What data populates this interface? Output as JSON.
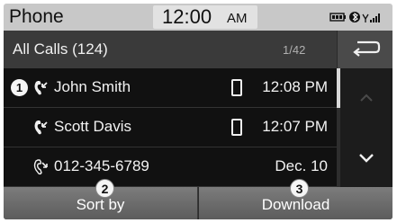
{
  "status_bar": {
    "app_title": "Phone",
    "time": "12:00",
    "ampm": "AM",
    "icons": [
      "battery-icon",
      "bluetooth-icon",
      "signal-icon"
    ]
  },
  "header": {
    "title": "All Calls (124)",
    "page_counter": "1/42",
    "back_icon": "back-arrow-icon"
  },
  "calls": [
    {
      "name": "John Smith",
      "time": "12:08 PM",
      "type": "incoming",
      "device_icon": "phone-device-icon",
      "badge": "1"
    },
    {
      "name": "Scott Davis",
      "time": "12:07 PM",
      "type": "incoming",
      "device_icon": "phone-device-icon"
    },
    {
      "name": "012-345-6789",
      "time": "Dec. 10",
      "type": "missed"
    }
  ],
  "scroll": {
    "up_icon": "chevron-up-icon",
    "down_icon": "chevron-down-icon"
  },
  "bottom": {
    "sort_label": "Sort by",
    "sort_badge": "2",
    "download_label": "Download",
    "download_badge": "3"
  },
  "colors": {
    "status_bar": "#c8c8c8",
    "header": "#3a3a3a",
    "list_bg": "#111111",
    "button": "#6c6c6c"
  }
}
